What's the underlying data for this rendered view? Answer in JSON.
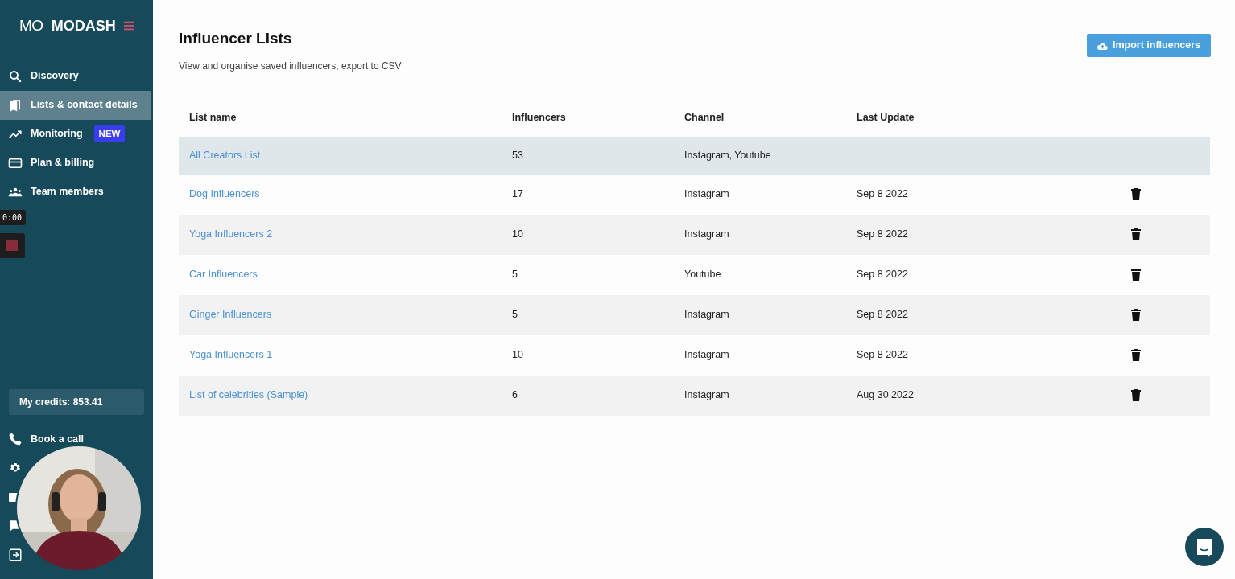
{
  "sidebar": {
    "logo_mark": "MO",
    "brand": "MODASH",
    "nav": [
      {
        "label": "Discovery",
        "selected": false
      },
      {
        "label": "Lists & contact details",
        "selected": true
      },
      {
        "label": "Monitoring",
        "selected": false,
        "badge": "NEW"
      },
      {
        "label": "Plan & billing",
        "selected": false
      },
      {
        "label": "Team members",
        "selected": false
      }
    ],
    "recorder": {
      "time": "0:00"
    },
    "credits": "My credits: 853.41",
    "bottom_link": "Book a call"
  },
  "page": {
    "title": "Influencer Lists",
    "subtitle": "View and organise saved influencers, export to CSV",
    "import_button": "Import influencers"
  },
  "table": {
    "columns": [
      "List name",
      "Influencers",
      "Channel",
      "Last Update"
    ],
    "rows": [
      {
        "name": "All Creators List",
        "influencers": "53",
        "channel": "Instagram, Youtube",
        "updated": "",
        "selected": true,
        "deletable": false
      },
      {
        "name": "Dog Influencers",
        "influencers": "17",
        "channel": "Instagram",
        "updated": "Sep 8 2022",
        "selected": false,
        "deletable": true
      },
      {
        "name": "Yoga Influencers 2",
        "influencers": "10",
        "channel": "Instagram",
        "updated": "Sep 8 2022",
        "selected": false,
        "deletable": true
      },
      {
        "name": "Car Influencers",
        "influencers": "5",
        "channel": "Youtube",
        "updated": "Sep 8 2022",
        "selected": false,
        "deletable": true
      },
      {
        "name": "Ginger Influencers",
        "influencers": "5",
        "channel": "Instagram",
        "updated": "Sep 8 2022",
        "selected": false,
        "deletable": true
      },
      {
        "name": "Yoga Influencers 1",
        "influencers": "10",
        "channel": "Instagram",
        "updated": "Sep 8 2022",
        "selected": false,
        "deletable": true
      },
      {
        "name": "List of celebrities (Sample)",
        "influencers": "6",
        "channel": "Instagram",
        "updated": "Aug 30 2022",
        "selected": false,
        "deletable": true
      }
    ]
  }
}
